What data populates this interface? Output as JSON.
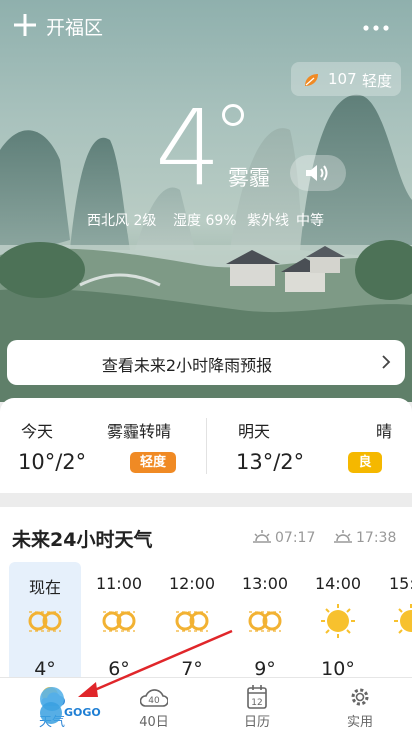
{
  "header": {
    "city": "开福区"
  },
  "aqi": {
    "value": "107",
    "level": "轻度"
  },
  "current": {
    "temperature": "4",
    "condition": "雾霾",
    "wind": "西北风 2级",
    "humidity": "湿度 69%",
    "uv_label": "紫外线",
    "uv_value": "中等"
  },
  "rain_forecast": {
    "label": "查看未来2小时降雨预报"
  },
  "today": {
    "label": "今天",
    "condition": "雾霾转晴",
    "temp": "10°/2°",
    "aqi": "轻度",
    "aqi_color": "#f08a24"
  },
  "tomorrow": {
    "label": "明天",
    "condition": "晴",
    "temp": "13°/2°",
    "aqi": "良",
    "aqi_color": "#f5b800"
  },
  "hourly": {
    "title": "未来24小时天气",
    "sunrise": "07:17",
    "sunset": "17:38",
    "items": [
      {
        "time": "现在",
        "icon": "haze-icon",
        "temp": "4°"
      },
      {
        "time": "11:00",
        "icon": "haze-icon",
        "temp": "6°"
      },
      {
        "time": "12:00",
        "icon": "haze-icon",
        "temp": "7°"
      },
      {
        "time": "13:00",
        "icon": "haze-icon",
        "temp": "9°"
      },
      {
        "time": "14:00",
        "icon": "sun-icon",
        "temp": "10°"
      },
      {
        "time": "15:",
        "icon": "sun-icon",
        "temp": ""
      }
    ]
  },
  "tabs": [
    {
      "label": "天气",
      "icon": "weather-icon"
    },
    {
      "label": "40日",
      "icon": "forty-day-icon",
      "badge": "40"
    },
    {
      "label": "日历",
      "icon": "calendar-icon",
      "badge": "12"
    },
    {
      "label": "实用",
      "icon": "settings-icon"
    }
  ],
  "watermark": {
    "text": "GOGO手游网"
  },
  "colors": {
    "accent_blue": "#2f86d6",
    "aqi_orange": "#f08a24",
    "arrow_red": "#e0262a"
  }
}
